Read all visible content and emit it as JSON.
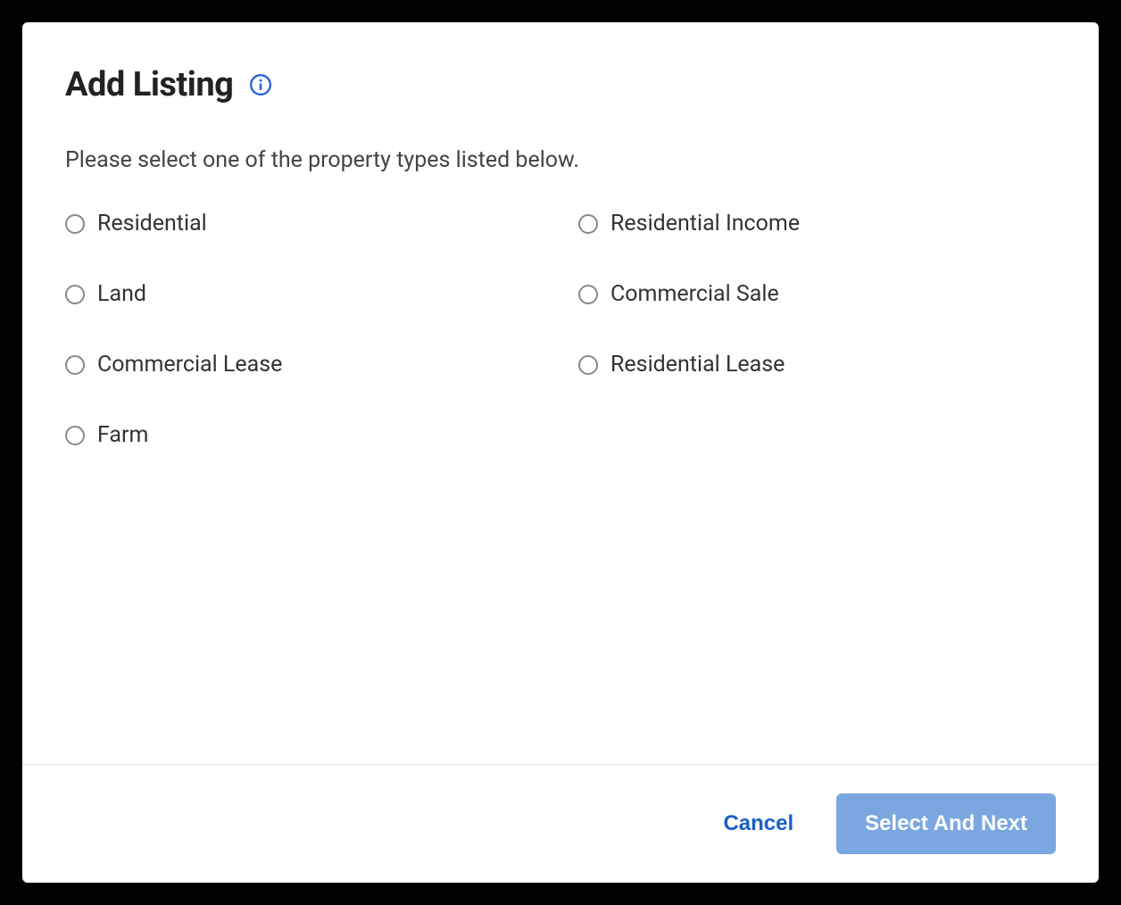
{
  "modal": {
    "title": "Add Listing",
    "instruction": "Please select one of the property types listed below.",
    "options": [
      {
        "label": "Residential"
      },
      {
        "label": "Residential Income"
      },
      {
        "label": "Land"
      },
      {
        "label": "Commercial Sale"
      },
      {
        "label": "Commercial Lease"
      },
      {
        "label": "Residential Lease"
      },
      {
        "label": "Farm"
      }
    ],
    "footer": {
      "cancel_label": "Cancel",
      "next_label": "Select And Next"
    }
  }
}
